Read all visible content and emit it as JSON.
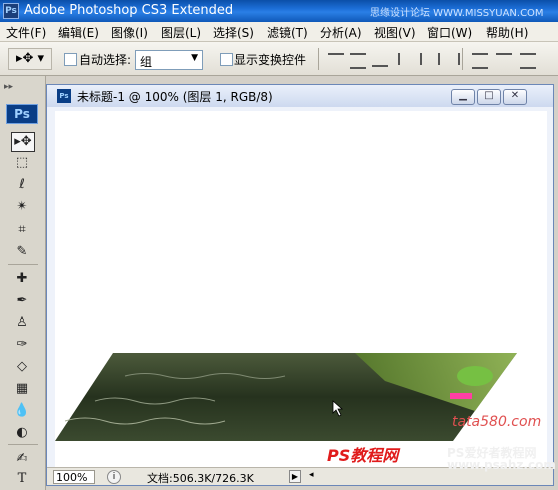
{
  "app": {
    "title": "Adobe Photoshop CS3 Extended",
    "icon_text": "Ps"
  },
  "watermark_top": "思缘设计论坛 WWW.MISSYUAN.COM",
  "menu": [
    "文件(F)",
    "编辑(E)",
    "图像(I)",
    "图层(L)",
    "选择(S)",
    "滤镜(T)",
    "分析(A)",
    "视图(V)",
    "窗口(W)",
    "帮助(H)"
  ],
  "options": {
    "auto_select_label": "自动选择:",
    "auto_select_value": "组",
    "show_transform_label": "显示变换控件"
  },
  "toolbox": {
    "logo": "Ps",
    "type_tool": "T"
  },
  "document": {
    "title": "未标题-1 @ 100% (图层 1, RGB/8)",
    "zoom": "100%",
    "info": "文档:506.3K/726.3K"
  },
  "watermarks": {
    "w1": "PS教程网",
    "w2": "PS爱好者教程网",
    "w3": "www.psahz.com",
    "w4": "tata580.com"
  },
  "colors": {
    "title_blue": "#1d6fd8",
    "water_dark": "#2f3b25",
    "grass": "#6e9a38"
  }
}
